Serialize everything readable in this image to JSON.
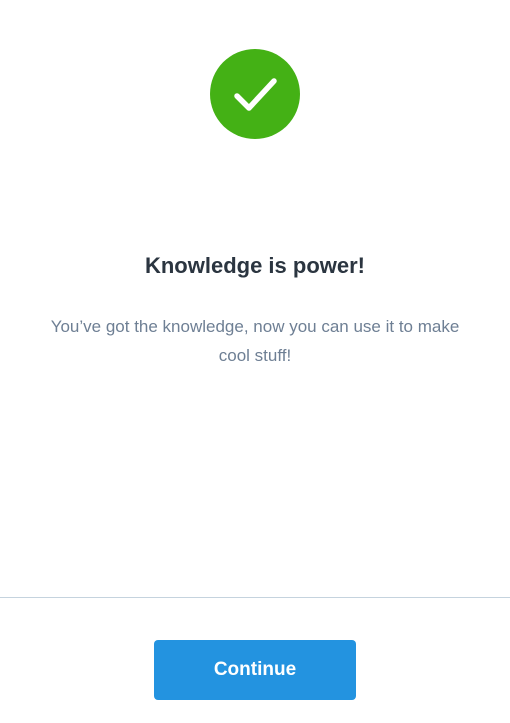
{
  "dialog": {
    "icon": "checkmark-icon",
    "title": "Knowledge is power!",
    "message": "You’ve got the knowledge, now you can use it to make cool stuff!",
    "continue_label": "Continue"
  },
  "colors": {
    "success_green": "#44b115",
    "title_text": "#2b3540",
    "message_text": "#6e7f94",
    "divider": "#c5d3de",
    "button_blue": "#2393e0",
    "button_text": "#ffffff"
  }
}
